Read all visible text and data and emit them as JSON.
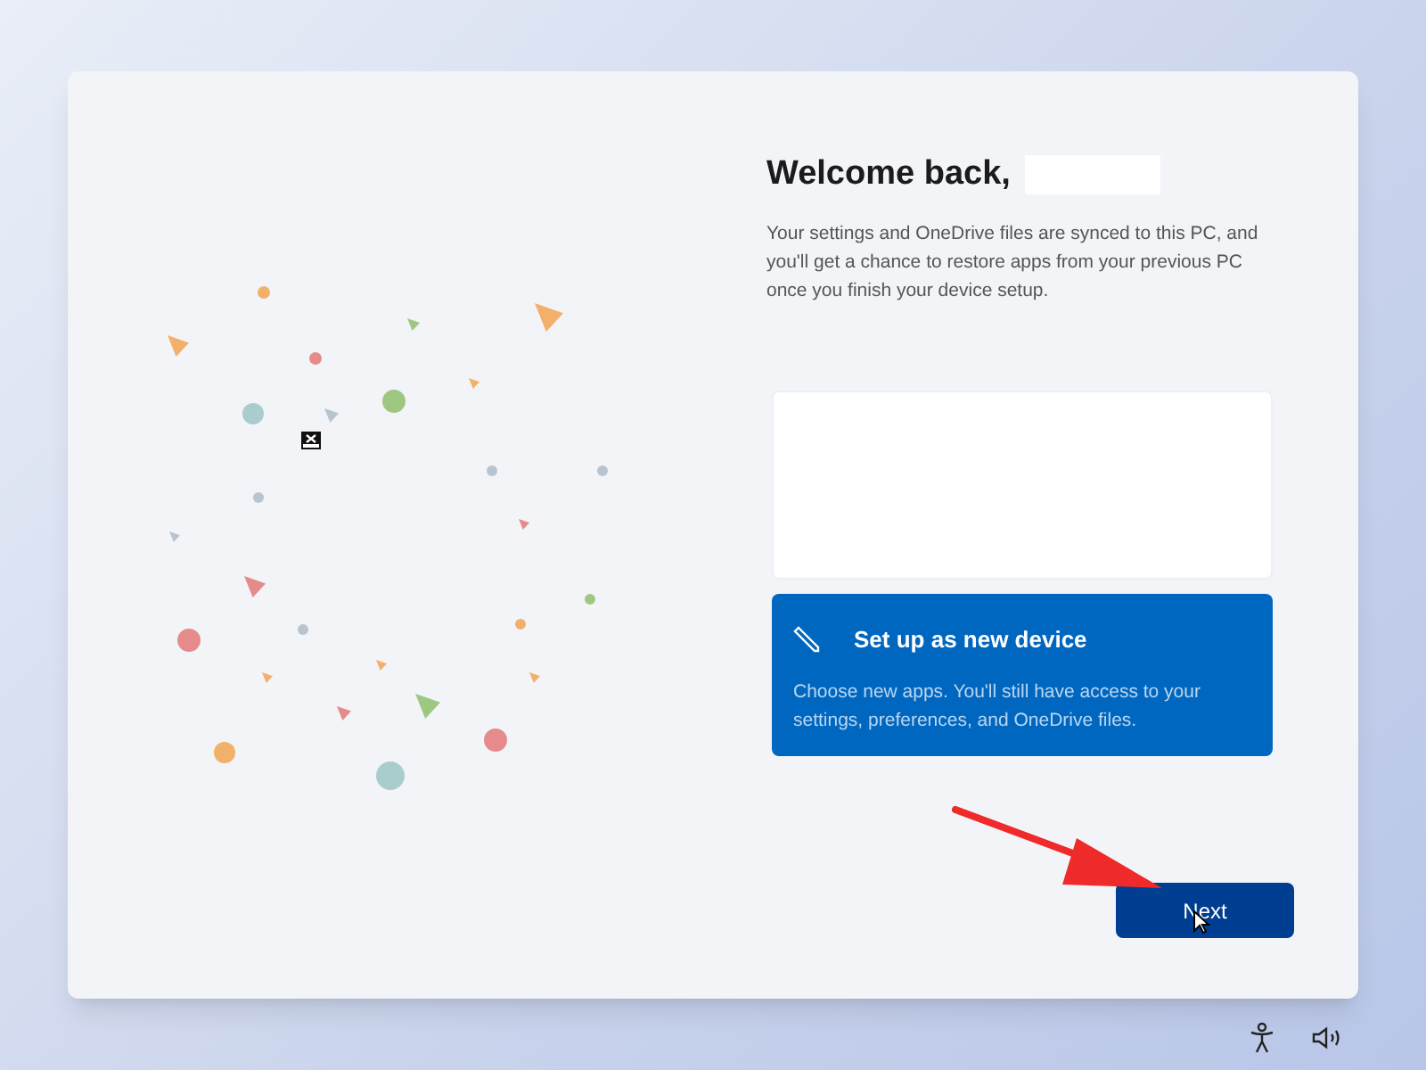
{
  "heading": "Welcome back,",
  "description": "Your settings and OneDrive files are synced to this PC, and you'll get a chance to restore apps from your previous PC once you finish your device setup.",
  "options": [
    {
      "selected": false
    },
    {
      "title": "Set up as new device",
      "description": "Choose new apps. You'll still have access to your settings, preferences, and OneDrive files.",
      "selected": true
    }
  ],
  "next_button": "Next"
}
